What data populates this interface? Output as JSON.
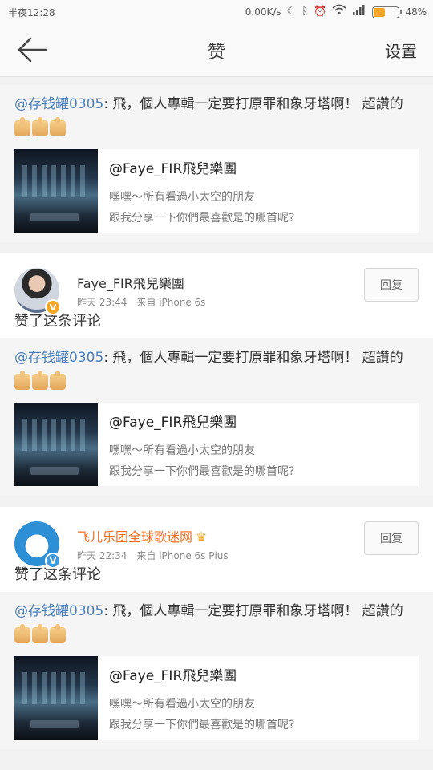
{
  "status_bar": {
    "time": "半夜12:28",
    "speed": "0.00K/s",
    "battery_text": "48%",
    "battery_level": 0.48,
    "icons": [
      "moon-icon",
      "bluetooth-icon",
      "alarm-icon",
      "wifi-icon",
      "signal-icon",
      "battery-icon"
    ]
  },
  "nav": {
    "back_icon": "arrow-left-icon",
    "title": "赞",
    "settings": "设置"
  },
  "quoted": {
    "mention": "@存钱罐0305",
    "text_after": ": 飛，個人專輯一定要打原罪和象牙塔啊！ 超讚的",
    "emoji_count": 3
  },
  "card": {
    "title": "@Faye_FIR飛兒樂團",
    "line1": "嘿嘿～所有看過小太空的朋友",
    "line2": "跟我分享一下你們最喜歡是的哪首呢?"
  },
  "items": [
    {
      "user": "Faye_FIR飛兒樂團",
      "meta": "昨天 23:44　来自 iPhone 6s",
      "reply": "回复",
      "action": "赞了这条评论",
      "badge_color": "#f5a623"
    },
    {
      "user": "飞儿乐团全球歌迷网",
      "meta": "昨天 22:34　来自 iPhone 6s Plus",
      "reply": "回复",
      "action": "赞了这条评论",
      "badge_color": "#3f9be0"
    }
  ],
  "colors": {
    "mention": "#4a7fbd",
    "orange_name": "#f76b1c"
  }
}
